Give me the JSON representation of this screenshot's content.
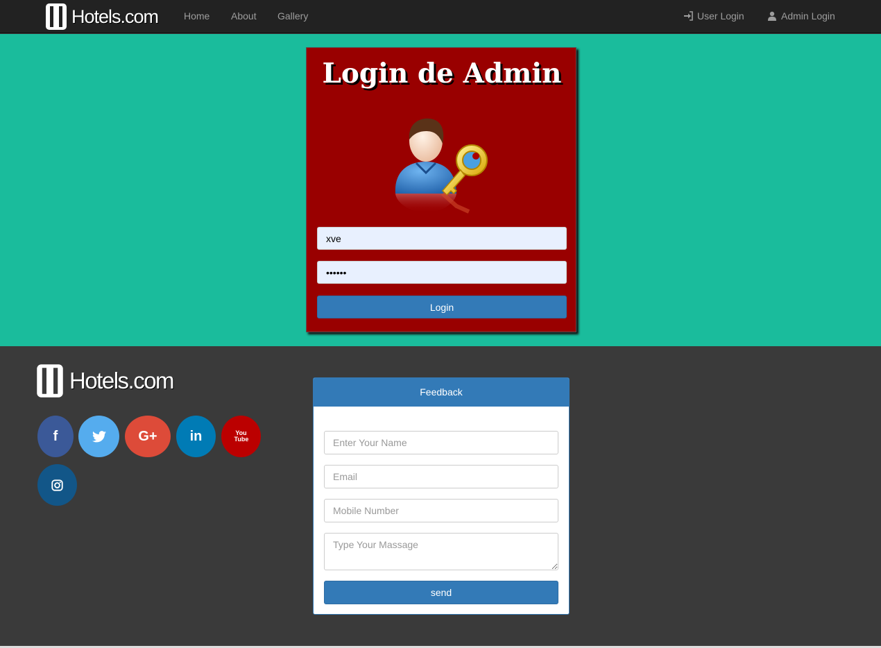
{
  "navbar": {
    "brand": "Hotels.com",
    "links": [
      "Home",
      "About",
      "Gallery"
    ],
    "right_links": [
      "User Login",
      "Admin Login"
    ]
  },
  "login": {
    "title": "Login de Admin",
    "username_value": "xve",
    "password_value": "••••••",
    "button_label": "Login"
  },
  "footer": {
    "brand": "Hotels.com",
    "social_icons": [
      "facebook-icon",
      "twitter-icon",
      "google-plus-icon",
      "linkedin-icon",
      "youtube-icon",
      "instagram-icon"
    ],
    "social_glyphs": [
      "f",
      "t",
      "G+",
      "in",
      "You Tube",
      ""
    ],
    "social_colors": [
      "#3b5998",
      "#55acee",
      "#dd4b39",
      "#007bb5",
      "#bb0000",
      "#125688"
    ],
    "feedback": {
      "title": "Feedback",
      "name_placeholder": "Enter Your Name",
      "email_placeholder": "Email",
      "mobile_placeholder": "Mobile Number",
      "message_placeholder": "Type Your Massage",
      "button_label": "send"
    }
  }
}
